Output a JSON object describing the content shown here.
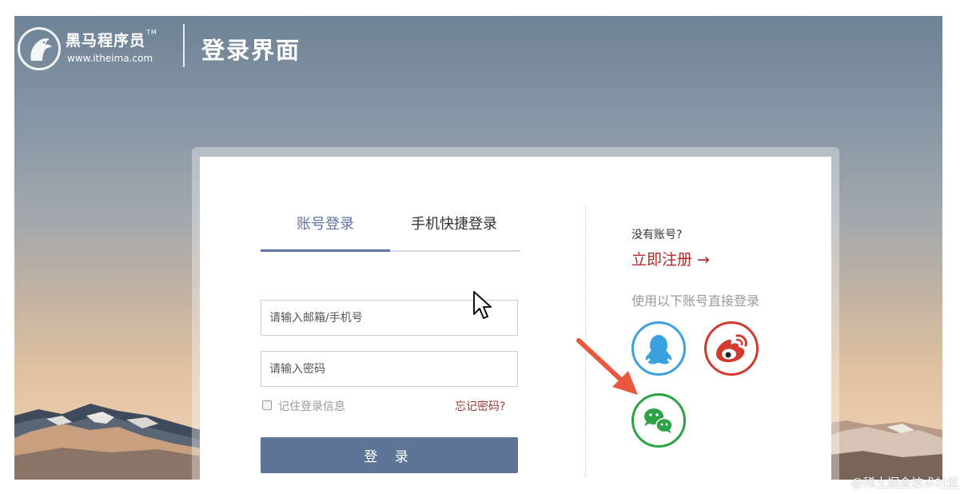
{
  "header": {
    "brand_name": "黑马程序员",
    "brand_tm": "TM",
    "brand_url": "www.itheima.com",
    "page_title": "登录界面"
  },
  "login": {
    "tabs": [
      {
        "label": "账号登录",
        "active": true
      },
      {
        "label": "手机快捷登录",
        "active": false
      }
    ],
    "account_placeholder": "请输入邮箱/手机号",
    "account_value": "",
    "password_placeholder": "请输入密码",
    "password_value": "",
    "remember_label": "记住登录信息",
    "remember_checked": false,
    "forgot_label": "忘记密码?",
    "submit_label": "登 录"
  },
  "side": {
    "no_account": "没有账号?",
    "register_label": "立即注册 →",
    "third_party_tip": "使用以下账号直接登录",
    "providers": [
      {
        "name": "qq-icon",
        "color": "#3ba0e0"
      },
      {
        "name": "weibo-icon",
        "color": "#d33a2f"
      },
      {
        "name": "wechat-icon",
        "color": "#2ba245"
      }
    ]
  },
  "colors": {
    "accent": "#5d73a8",
    "button": "#5f7597",
    "register": "#b02a2a",
    "annotation_arrow": "#e9573f"
  },
  "watermark": "@稀土掘金技术社区"
}
